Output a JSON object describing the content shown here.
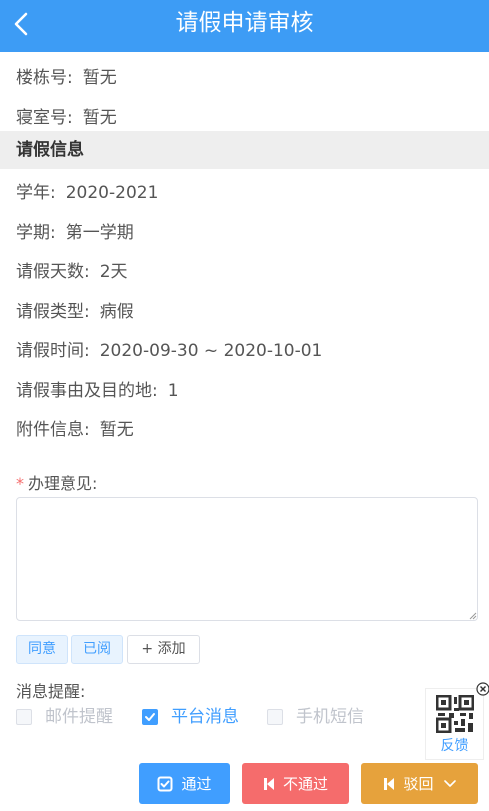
{
  "header": {
    "title": "请假申请审核"
  },
  "info_top": [
    {
      "label": "楼栋号:",
      "value": "暂无"
    },
    {
      "label": "寝室号:",
      "value": "暂无"
    }
  ],
  "section": {
    "title": "请假信息"
  },
  "details": [
    {
      "label": "学年:",
      "value": "2020-2021"
    },
    {
      "label": "学期:",
      "value": "第一学期"
    },
    {
      "label": "请假天数:",
      "value": "2天"
    },
    {
      "label": "请假类型:",
      "value": "病假"
    },
    {
      "label": "请假时间:",
      "value": "2020-09-30 ~ 2020-10-01"
    },
    {
      "label": "请假事由及目的地:",
      "value": "1"
    },
    {
      "label": "附件信息:",
      "value": "暂无"
    }
  ],
  "opinion": {
    "required_mark": "*",
    "label": "办理意见:",
    "value": "",
    "quick_tags": [
      "同意",
      "已阅"
    ],
    "add_label": "+ 添加"
  },
  "reminder": {
    "label": "消息提醒:",
    "options": [
      {
        "label": "邮件提醒",
        "checked": false
      },
      {
        "label": "平台消息",
        "checked": true
      },
      {
        "label": "手机短信",
        "checked": false
      }
    ]
  },
  "feedback": {
    "label": "反馈"
  },
  "actions": {
    "pass": "通过",
    "reject": "不通过",
    "return": "驳回"
  },
  "colors": {
    "header": "#3d9cf5",
    "primary": "#409eff",
    "danger": "#f56c6c",
    "warning": "#e6a23c",
    "section_bg": "#eeeeee"
  }
}
